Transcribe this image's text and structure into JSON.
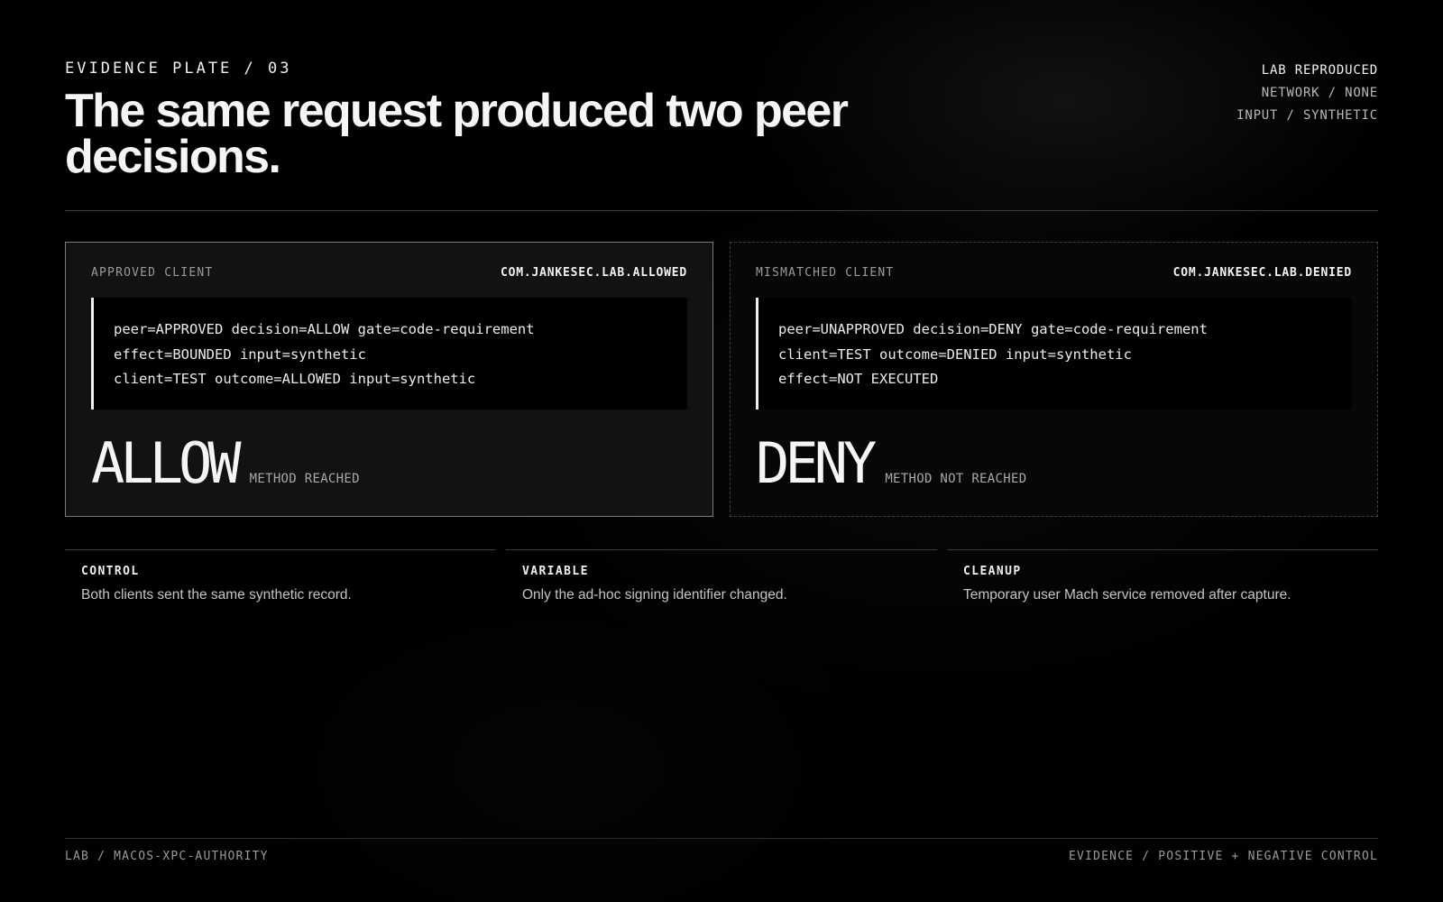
{
  "header": {
    "kicker": "EVIDENCE PLATE / 03",
    "title": "The same request produced two peer decisions.",
    "meta": {
      "status": "LAB REPRODUCED",
      "network": "NETWORK / NONE",
      "input": "INPUT / SYNTHETIC"
    }
  },
  "panels": {
    "approved": {
      "label": "APPROVED CLIENT",
      "identifier": "COM.JANKESEC.LAB.ALLOWED",
      "log_lines": [
        "peer=APPROVED decision=ALLOW gate=code-requirement",
        "effect=BOUNDED input=synthetic",
        "client=TEST outcome=ALLOWED input=synthetic"
      ],
      "verdict": "ALLOW",
      "verdict_note": "METHOD REACHED"
    },
    "mismatched": {
      "label": "MISMATCHED CLIENT",
      "identifier": "COM.JANKESEC.LAB.DENIED",
      "log_lines": [
        "peer=UNAPPROVED decision=DENY gate=code-requirement",
        "client=TEST outcome=DENIED input=synthetic",
        "effect=NOT EXECUTED"
      ],
      "verdict": "DENY",
      "verdict_note": "METHOD NOT REACHED"
    }
  },
  "facts": [
    {
      "label": "CONTROL",
      "text": "Both clients sent the same synthetic record."
    },
    {
      "label": "VARIABLE",
      "text": "Only the ad-hoc signing identifier changed."
    },
    {
      "label": "CLEANUP",
      "text": "Temporary user Mach service removed after capture."
    }
  ],
  "footer": {
    "left": "LAB / MACOS-XPC-AUTHORITY",
    "right": "EVIDENCE / POSITIVE + NEGATIVE CONTROL"
  },
  "colors": {
    "background": "#000000",
    "text": "#f2f2f2",
    "muted": "#9a9a9a",
    "panel_approved_bg": "#121212",
    "panel_approved_border": "#7a7a7a",
    "panel_mismatched_border": "#404040"
  }
}
